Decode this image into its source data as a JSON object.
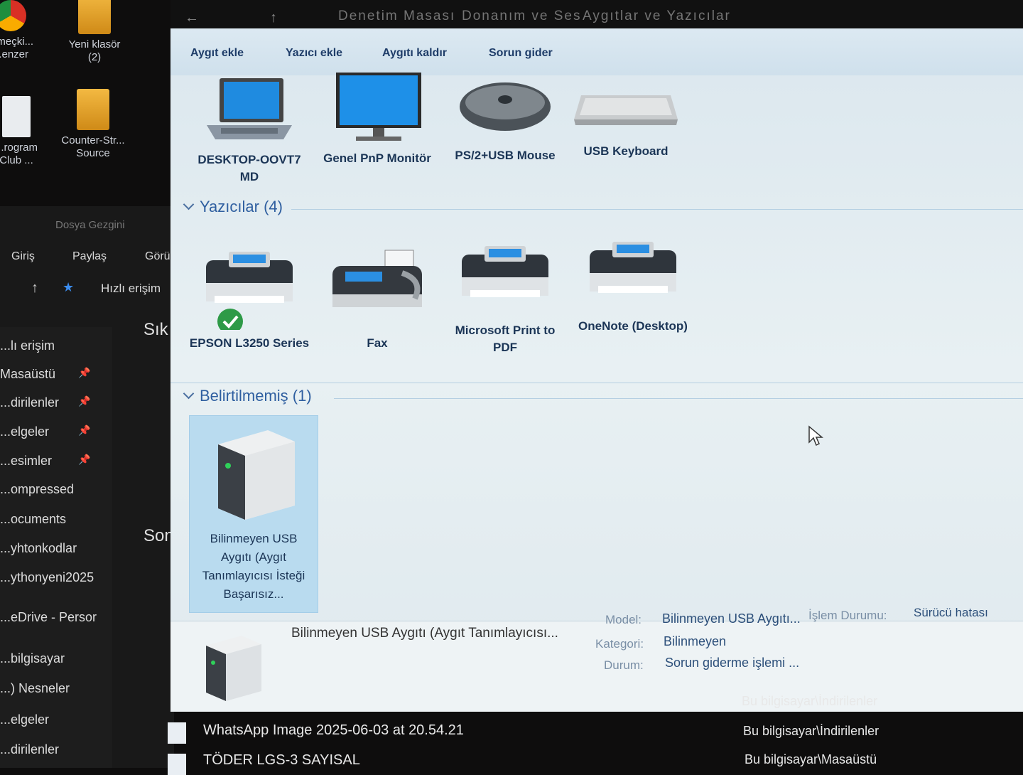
{
  "desktop": {
    "icons": [
      {
        "label": "...meçki... ...enzer",
        "kind": "chrome"
      },
      {
        "label": "Yeni klasör (2)",
        "kind": "folder"
      },
      {
        "label": "...rogram Club ...",
        "kind": "file"
      },
      {
        "label": "Counter-Str... Source",
        "kind": "folder"
      }
    ]
  },
  "bg_explorer": {
    "title": "Dosya Gezgini",
    "ribbon": [
      "Giriş",
      "Paylaş",
      "Görü"
    ],
    "address": "Hızlı erişim",
    "section_frequent": "Sık",
    "section_recent": "Son",
    "nav": [
      {
        "label": "...lı erişim",
        "pinned": false
      },
      {
        "label": "Masaüstü",
        "pinned": true
      },
      {
        "label": "...dirilenler",
        "pinned": true
      },
      {
        "label": "...elgeler",
        "pinned": true
      },
      {
        "label": "...esimler",
        "pinned": true
      },
      {
        "label": "...ompressed",
        "pinned": false
      },
      {
        "label": "...ocuments",
        "pinned": false
      },
      {
        "label": "...yhtonkodlar",
        "pinned": false
      },
      {
        "label": "...ythonyeni2025",
        "pinned": false
      },
      {
        "label": "...eDrive - Persor",
        "pinned": false
      },
      {
        "label": "...bilgisayar",
        "pinned": false
      },
      {
        "label": "...) Nesneler",
        "pinned": false
      },
      {
        "label": "...elgeler",
        "pinned": false
      },
      {
        "label": "...dirilenler",
        "pinned": false
      }
    ]
  },
  "window": {
    "breadcrumb": [
      "Denetim Masası",
      "Donanım ve Ses",
      "Aygıtlar ve Yazıcılar"
    ],
    "commands": [
      "Aygıt ekle",
      "Yazıcı ekle",
      "Aygıtı kaldır",
      "Sorun gider"
    ],
    "devices": [
      {
        "label": "DESKTOP-OOVT7 MD",
        "icon": "laptop-icon"
      },
      {
        "label": "Genel PnP Monitör",
        "icon": "monitor-icon"
      },
      {
        "label": "PS/2+USB Mouse",
        "icon": "mouse-icon"
      },
      {
        "label": "USB Keyboard",
        "icon": "keyboard-icon"
      }
    ],
    "printers_header": "Yazıcılar (4)",
    "printers": [
      {
        "label": "EPSON L3250 Series",
        "icon": "printer-icon",
        "default": true
      },
      {
        "label": "Fax",
        "icon": "fax-icon",
        "default": false
      },
      {
        "label": "Microsoft Print to PDF",
        "icon": "printer-icon",
        "default": false
      },
      {
        "label": "OneNote (Desktop)",
        "icon": "printer-icon",
        "default": false
      }
    ],
    "unspecified_header": "Belirtilmemiş (1)",
    "unspecified": [
      {
        "label": "Bilinmeyen USB Aygıtı (Aygıt Tanımlayıcısı İsteği Başarısız...",
        "icon": "unknown-device-icon"
      }
    ],
    "details": {
      "title": "Bilinmeyen USB Aygıtı (Aygıt Tanımlayıcısı...",
      "model_label": "Model:",
      "model_value": "Bilinmeyen USB Aygıtı...",
      "status_label": "İşlem Durumu:",
      "status_value": "Sürücü hatası",
      "category_label": "Kategori:",
      "category_value": "Bilinmeyen",
      "state_label": "Durum:",
      "state_value": "Sorun giderme işlemi ..."
    }
  },
  "recent_files": [
    {
      "name": "WhatsApp Image 2025-06-03 at 20.54.21",
      "path": "Bu bilgisayar\\İndirilenler"
    },
    {
      "name": "TÖDER LGS-3 SAYISAL",
      "path": "Bu bilgisayar\\İndirilenler"
    },
    {
      "name": "",
      "path": "Bu bilgisayar\\Masaüstü"
    }
  ]
}
